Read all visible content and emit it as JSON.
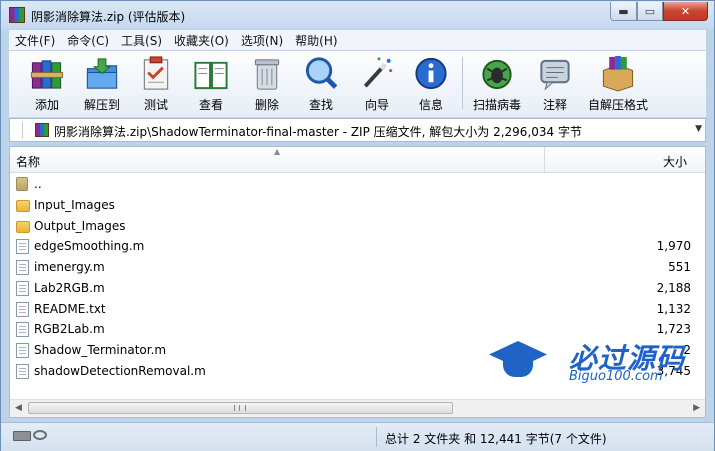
{
  "window": {
    "title": "阴影消除算法.zip (评估版本)",
    "min_glyph": "▬",
    "max_glyph": "▭",
    "close_glyph": "✕"
  },
  "menu": [
    "文件(F)",
    "命令(C)",
    "工具(S)",
    "收藏夹(O)",
    "选项(N)",
    "帮助(H)"
  ],
  "toolbar": [
    {
      "label": "添加",
      "icon": "add-books-icon"
    },
    {
      "label": "解压到",
      "icon": "extract-folder-icon"
    },
    {
      "label": "测试",
      "icon": "test-clipboard-icon"
    },
    {
      "label": "查看",
      "icon": "view-book-icon"
    },
    {
      "label": "删除",
      "icon": "trash-icon"
    },
    {
      "label": "查找",
      "icon": "search-magnifier-icon"
    },
    {
      "label": "向导",
      "icon": "wizard-wand-icon"
    },
    {
      "label": "信息",
      "icon": "info-icon"
    },
    {
      "label": "扫描病毒",
      "icon": "virus-scan-icon"
    },
    {
      "label": "注释",
      "icon": "comment-icon"
    },
    {
      "label": "自解压格式",
      "icon": "sfx-box-icon"
    }
  ],
  "address": {
    "path": "阴影消除算法.zip\\ShadowTerminator-final-master - ZIP 压缩文件, 解包大小为 2,296,034 字节"
  },
  "columns": {
    "name": "名称",
    "size": "大小"
  },
  "files": [
    {
      "name": "..",
      "size": "",
      "type": "up"
    },
    {
      "name": "Input_Images",
      "size": "",
      "type": "folder"
    },
    {
      "name": "Output_Images",
      "size": "",
      "type": "folder"
    },
    {
      "name": "edgeSmoothing.m",
      "size": "1,970",
      "type": "file"
    },
    {
      "name": "imenergy.m",
      "size": "551",
      "type": "file"
    },
    {
      "name": "Lab2RGB.m",
      "size": "2,188",
      "type": "file"
    },
    {
      "name": "README.txt",
      "size": "1,132",
      "type": "file"
    },
    {
      "name": "RGB2Lab.m",
      "size": "1,723",
      "type": "file"
    },
    {
      "name": "Shadow_Terminator.m",
      "size": "2",
      "type": "file"
    },
    {
      "name": "shadowDetectionRemoval.m",
      "size": "3,745",
      "type": "file"
    }
  ],
  "status": {
    "summary": "总计 2 文件夹 和 12,441 字节(7 个文件)"
  },
  "watermark": {
    "title": "必过源码",
    "subtitle": "Biguo100.com"
  },
  "colors": {
    "accent": "#1f63c5",
    "titlebar": "#c4d8ef",
    "close": "#c8452e"
  }
}
